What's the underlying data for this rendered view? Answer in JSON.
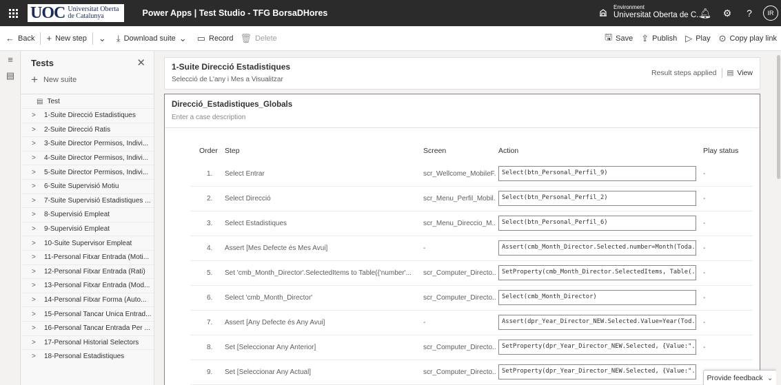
{
  "topbar": {
    "logo_mark": "UOC",
    "logo_line1": "Universitat Oberta",
    "logo_line2": "de Catalunya",
    "app_title": "Power Apps | Test Studio - TFG BorsaDHores",
    "env_label": "Environment",
    "env_name": "Universitat Oberta de C...",
    "avatar_initials": "IR"
  },
  "commands": {
    "back": "Back",
    "new_step": "New step",
    "download_suite": "Download suite",
    "record": "Record",
    "delete": "Delete",
    "save": "Save",
    "publish": "Publish",
    "play": "Play",
    "copy_play_link": "Copy play link"
  },
  "panel": {
    "title": "Tests",
    "new_suite": "New suite",
    "test_item": "Test",
    "suites": [
      "1-Suite Direcció Estadistiques",
      "2-Suite Direcció Ratis",
      "3-Suite Director Permisos, Indivi...",
      "4-Suite Director Permisos, Indivi...",
      "5-Suite Director Permisos, Indivi...",
      "6-Suite Supervisió Motiu",
      "7-Suite Supervisió Estadistiques ...",
      "8-Supervisió Empleat",
      "9-Supervisió Empleat",
      "10-Suite Supervisor Empleat",
      "11-Personal Fitxar Entrada (Moti...",
      "12-Personal Fitxar Entrada (Rati)",
      "13-Personal Fitxar Entrada (Mod...",
      "14-Personal Fitxar Forma (Auto...",
      "15-Personal Tancar Unica Entrad...",
      "16-Personal Tancar Entrada Per ...",
      "17-Personal Historial Selectors",
      "18-Personal Estadistiques"
    ]
  },
  "suite": {
    "title": "1-Suite Direcció Estadistiques",
    "description": "Selecció de L'any i Mes a Visualitzar",
    "result_steps": "Result steps applied",
    "view": "View"
  },
  "case": {
    "title": "Direcció_Estadistiques_Globals",
    "description_placeholder": "Enter a case description",
    "headers": {
      "order": "Order",
      "step": "Step",
      "screen": "Screen",
      "action": "Action",
      "play_status": "Play status"
    },
    "rows": [
      {
        "order": "1.",
        "step": "Select Entrar",
        "screen": "scr_Wellcome_MobileF...",
        "action": "Select(btn_Personal_Perfil_9)",
        "status": "-"
      },
      {
        "order": "2.",
        "step": "Select Direcció",
        "screen": "scr_Menu_Perfil_Mobil...",
        "action": "Select(btn_Personal_Perfil_2)",
        "status": "-"
      },
      {
        "order": "3.",
        "step": "Select Estadistiques",
        "screen": "scr_Menu_Direccio_M...",
        "action": "Select(btn_Personal_Perfil_6)",
        "status": "-"
      },
      {
        "order": "4.",
        "step": "Assert [Mes Defecte és Mes Avui]",
        "screen": "-",
        "action": "Assert(cmb_Month_Director.Selected.number=Month(Toda...",
        "status": "-"
      },
      {
        "order": "5.",
        "step": "Set 'cmb_Month_Director'.SelectedItems to Table({'number'...",
        "screen": "scr_Computer_Directo...",
        "action": "SetProperty(cmb_Month_Director.SelectedItems, Table(...",
        "status": "-"
      },
      {
        "order": "6.",
        "step": "Select 'cmb_Month_Director'",
        "screen": "scr_Computer_Directo...",
        "action": "Select(cmb_Month_Director)",
        "status": "-"
      },
      {
        "order": "7.",
        "step": "Assert [Any Defecte és Any Avui]",
        "screen": "-",
        "action": "Assert(dpr_Year_Director_NEW.Selected.Value=Year(Tod...",
        "status": "-"
      },
      {
        "order": "8.",
        "step": "Set [Seleccionar Any Anterior]",
        "screen": "scr_Computer_Directo...",
        "action": "SetProperty(dpr_Year_Director_NEW.Selected, {Value:\"...",
        "status": "-"
      },
      {
        "order": "9.",
        "step": "Set [Seleccionar Any Actual]",
        "screen": "scr_Computer_Directo...",
        "action": "SetProperty(dpr_Year_Director_NEW.Selected, {Value:\"...",
        "status": ""
      }
    ]
  },
  "feedback": "Provide feedback"
}
